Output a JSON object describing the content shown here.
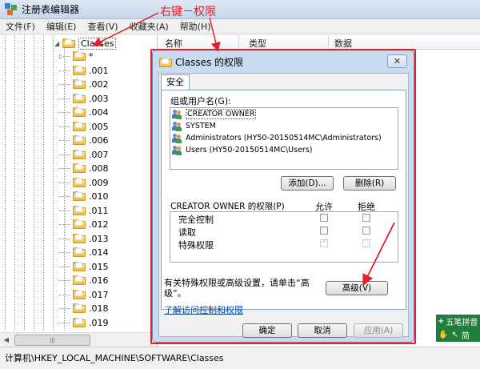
{
  "window": {
    "title": "注册表编辑器"
  },
  "menu": [
    "文件(F)",
    "编辑(E)",
    "查看(V)",
    "收藏夹(A)",
    "帮助(H)"
  ],
  "tree": {
    "selected": "Classes",
    "children": [
      "*",
      ".001",
      ".002",
      ".003",
      ".004",
      ".005",
      ".006",
      ".007",
      ".008",
      ".009",
      ".010",
      ".011",
      ".012",
      ".013",
      ".014",
      ".015",
      ".016",
      ".017",
      ".018",
      ".019"
    ]
  },
  "columns": [
    "名称",
    "类型",
    "数据"
  ],
  "status_path": "计算机\\HKEY_LOCAL_MACHINE\\SOFTWARE\\Classes",
  "ime": {
    "name": "五笔拼音",
    "symbols": [
      "✋",
      "↖",
      "简"
    ]
  },
  "annotation": "右键－权限",
  "dialog": {
    "title": "Classes 的权限",
    "close": "✕",
    "tab": "安全",
    "group_label": "组或用户名(G):",
    "users": [
      "CREATOR OWNER",
      "SYSTEM",
      "Administrators (HY50-20150514MC\\Administrators)",
      "Users (HY50-20150514MC\\Users)"
    ],
    "add_button": "添加(D)...",
    "remove_button": "删除(R)",
    "perm_label": "CREATOR OWNER 的权限(P)",
    "allow_label": "允许",
    "deny_label": "拒绝",
    "permissions": [
      {
        "name": "完全控制",
        "allow": false,
        "deny": false
      },
      {
        "name": "读取",
        "allow": false,
        "deny": false
      },
      {
        "name": "特殊权限",
        "allow": true,
        "deny": false
      }
    ],
    "special_note": "有关特殊权限或高级设置，请单击“高级”。",
    "advanced_button": "高级(V)",
    "learn_link": "了解访问控制和权限",
    "ok_button": "确定",
    "cancel_button": "取消",
    "apply_button": "应用(A)"
  },
  "colors": {
    "annotation": "#e0202a",
    "ime_bg": "#217d3b",
    "link": "#0645ad"
  }
}
